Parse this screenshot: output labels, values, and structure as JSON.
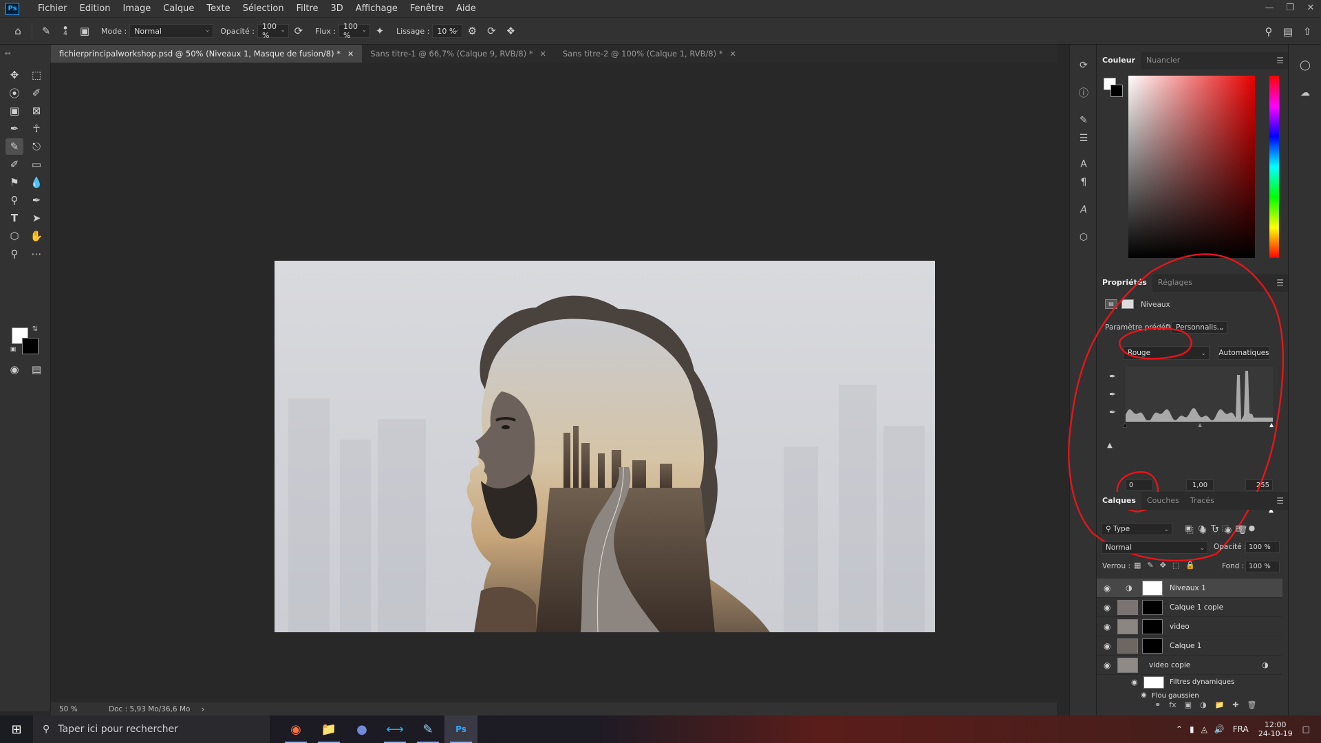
{
  "menubar": {
    "app_icon": "Ps",
    "items": [
      "Fichier",
      "Edition",
      "Image",
      "Calque",
      "Texte",
      "Sélection",
      "Filtre",
      "3D",
      "Affichage",
      "Fenêtre",
      "Aide"
    ]
  },
  "options": {
    "brush_size": "4",
    "mode_label": "Mode :",
    "mode_value": "Normal",
    "opacity_label": "Opacité :",
    "opacity_value": "100 %",
    "flux_label": "Flux :",
    "flux_value": "100 %",
    "lissage_label": "Lissage :",
    "lissage_value": "10 %"
  },
  "tabs": [
    {
      "label": "fichierprincipalworkshop.psd @ 50% (Niveaux 1, Masque de fusion/8) *",
      "active": true
    },
    {
      "label": "Sans titre-1 @ 66,7% (Calque 9, RVB/8) *",
      "active": false
    },
    {
      "label": "Sans titre-2 @ 100% (Calque 1, RVB/8) *",
      "active": false
    }
  ],
  "status": {
    "zoom": "50 %",
    "doc": "Doc : 5,93 Mo/36,6 Mo"
  },
  "color_panel": {
    "tabs": [
      "Couleur",
      "Nuancier"
    ]
  },
  "properties": {
    "tabs": [
      "Propriétés",
      "Réglages"
    ],
    "title": "Niveaux",
    "preset_label": "Paramètre prédéfini :",
    "preset_value": "Personnalis...",
    "channel_value": "Rouge",
    "auto_button": "Automatiques",
    "input_black": "0",
    "input_gamma": "1,00",
    "input_white": "255"
  },
  "layers_panel": {
    "tabs": [
      "Calques",
      "Couches",
      "Tracés"
    ],
    "filter_value": "Type",
    "blend_mode": "Normal",
    "opacity_label": "Opacité :",
    "opacity_value": "100 %",
    "lock_label": "Verrou :",
    "fill_label": "Fond :",
    "fill_value": "100 %",
    "layers": [
      {
        "name": "Niveaux 1",
        "selected": true
      },
      {
        "name": "Calque 1 copie",
        "selected": false
      },
      {
        "name": "video",
        "selected": false
      },
      {
        "name": "Calque 1",
        "selected": false
      },
      {
        "name": "video copie",
        "selected": false
      }
    ],
    "smart_filters_label": "Filtres dynamiques",
    "gaussian_label": "Flou gaussien"
  },
  "taskbar": {
    "search_placeholder": "Taper ici pour rechercher",
    "language": "FRA",
    "time": "12:00",
    "date": "24-10-19"
  },
  "colors": {
    "annotation_red": "#e8141a",
    "accent_blue": "#31a8ff"
  }
}
